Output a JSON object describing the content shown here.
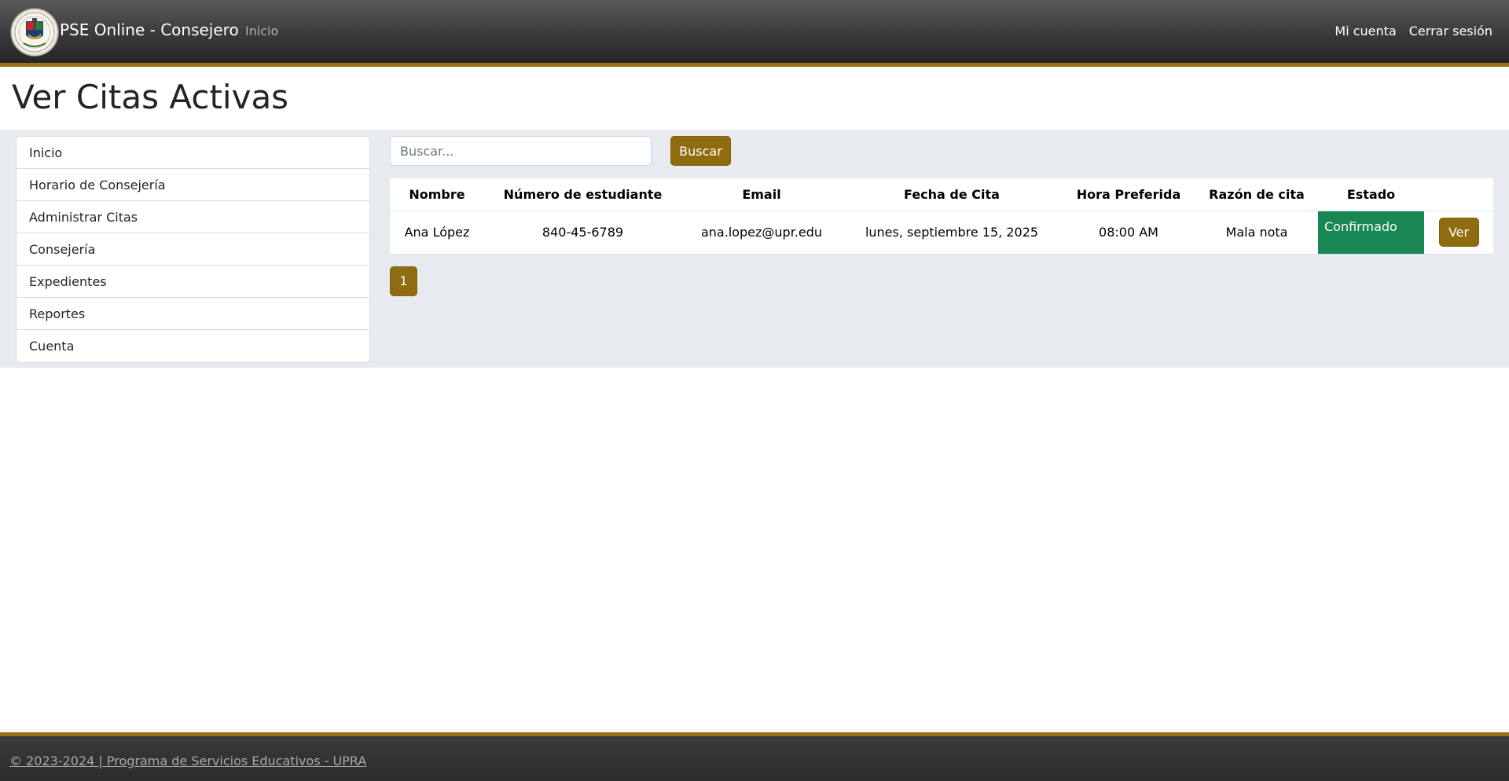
{
  "navbar": {
    "brand": "PSE Online - Consejero",
    "home_link": "Inicio",
    "account_link": "Mi cuenta",
    "logout_link": "Cerrar sesión"
  },
  "page": {
    "title": "Ver Citas Activas"
  },
  "sidebar": {
    "items": [
      {
        "label": "Inicio"
      },
      {
        "label": "Horario de Consejería"
      },
      {
        "label": "Administrar Citas"
      },
      {
        "label": "Consejería"
      },
      {
        "label": "Expedientes"
      },
      {
        "label": "Reportes"
      },
      {
        "label": "Cuenta"
      }
    ]
  },
  "search": {
    "placeholder": "Buscar...",
    "value": "",
    "button_label": "Buscar"
  },
  "table": {
    "headers": [
      "Nombre",
      "Número de estudiante",
      "Email",
      "Fecha de Cita",
      "Hora Preferida",
      "Razón de cita",
      "Estado",
      ""
    ],
    "rows": [
      {
        "nombre": "Ana López",
        "numero": "840-45-6789",
        "email": "ana.lopez@upr.edu",
        "fecha": "lunes, septiembre 15, 2025",
        "hora": "08:00 AM",
        "razon": "Mala nota",
        "estado": "Confirmado",
        "action_label": "Ver"
      }
    ]
  },
  "pagination": {
    "current_page": "1"
  },
  "footer": {
    "text": "© 2023-2024 | Programa de Servicios Educativos - UPRA"
  },
  "colors": {
    "accent_gold": "#8f6c10",
    "status_confirmed": "#198754",
    "navbar_bg": "#3a3a3a",
    "content_bg": "#e7eaee"
  },
  "icons": {
    "logo": "upra-seal-logo"
  }
}
